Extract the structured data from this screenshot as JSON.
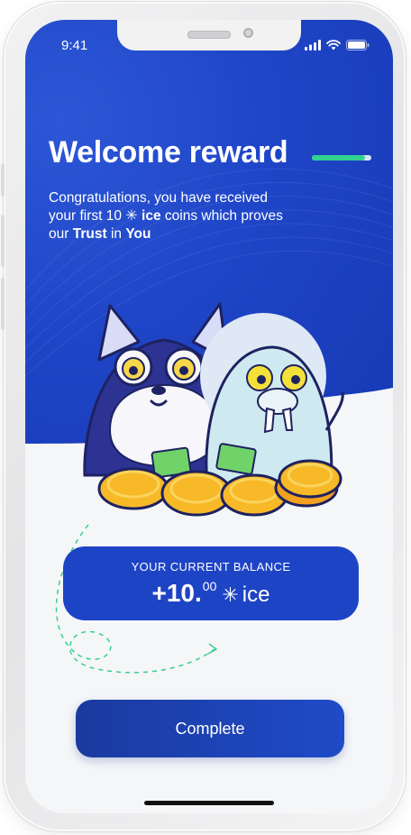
{
  "status_bar": {
    "time": "9:41"
  },
  "onboarding": {
    "progress": 0.9
  },
  "reward": {
    "title": "Welcome reward",
    "subtitle_line1": "Congratulations, you have received",
    "subtitle_pre": "your first 10",
    "ice_symbol": "✳",
    "subtitle_ice": "ice",
    "subtitle_post": "coins which proves",
    "subtitle_line3_pre": "our",
    "subtitle_trust": "Trust",
    "subtitle_line3_mid": "in",
    "subtitle_you": "You"
  },
  "balance": {
    "label": "YOUR CURRENT BALANCE",
    "integer": "+10.",
    "decimals": "00",
    "ice_symbol": "✳",
    "unit": "ice"
  },
  "actions": {
    "complete_label": "Complete"
  },
  "colors": {
    "primary_blue": "#1f46c8",
    "card_blue": "#1e44c6",
    "accent_green": "#33d18f",
    "coin_gold": "#f7b928"
  }
}
